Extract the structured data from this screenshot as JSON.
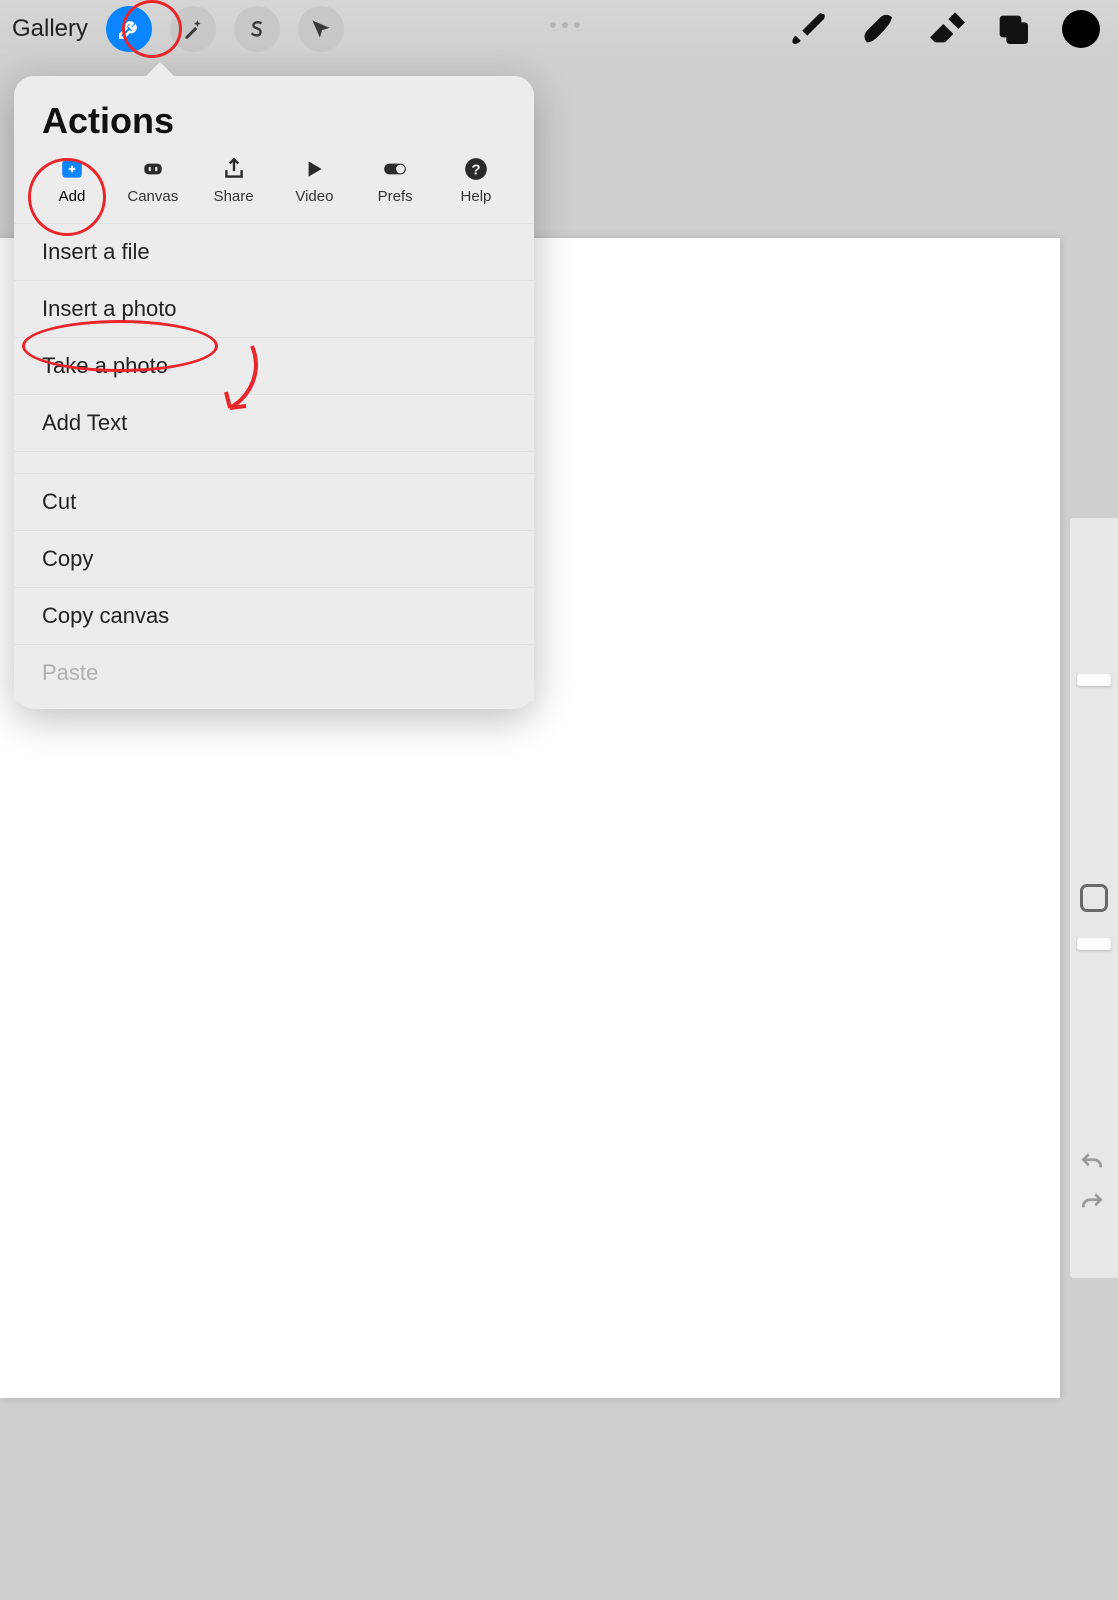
{
  "toolbar": {
    "gallery_label": "Gallery"
  },
  "popover": {
    "title": "Actions",
    "tabs": [
      {
        "label": "Add"
      },
      {
        "label": "Canvas"
      },
      {
        "label": "Share"
      },
      {
        "label": "Video"
      },
      {
        "label": "Prefs"
      },
      {
        "label": "Help"
      }
    ],
    "items_group1": [
      "Insert a file",
      "Insert a photo",
      "Take a photo",
      "Add Text"
    ],
    "items_group2": [
      "Cut",
      "Copy",
      "Copy canvas"
    ],
    "items_disabled": [
      "Paste"
    ]
  }
}
